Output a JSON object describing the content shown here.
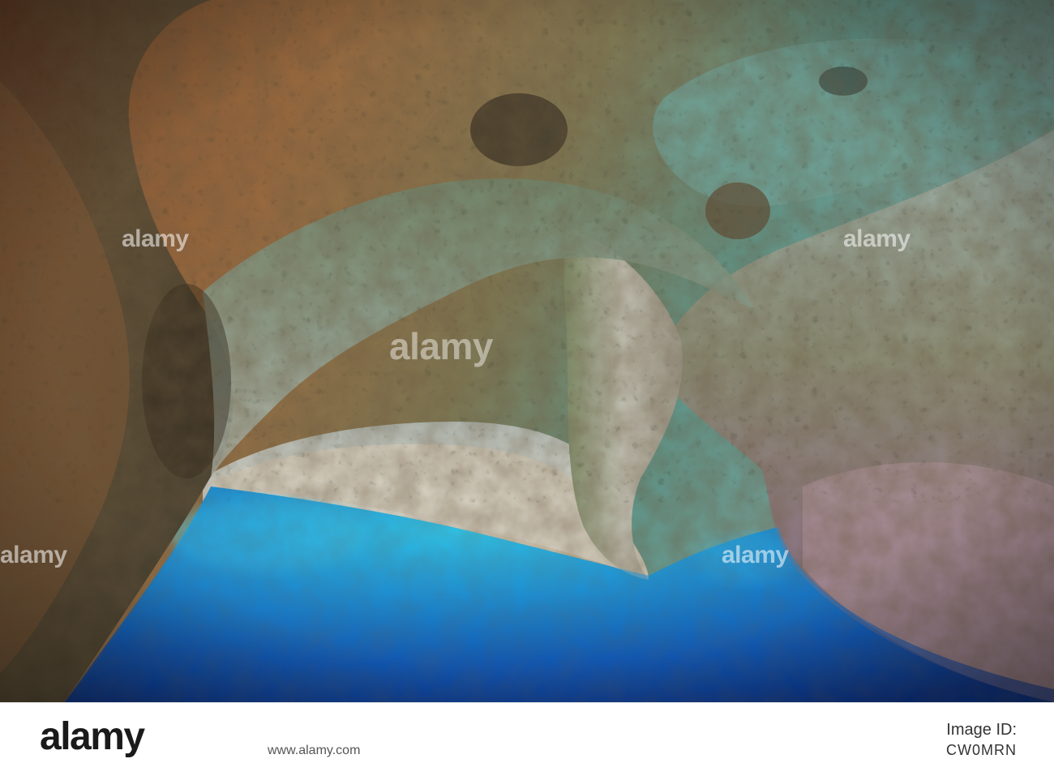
{
  "image": {
    "subject": "sea cave interior with turquoise water",
    "colors": {
      "water_light": "#27b4e0",
      "water_deep": "#0a3f9e",
      "rock_warm": "#a0603a",
      "rock_teal": "#4f8f86",
      "rock_pale": "#d8d6d0",
      "rock_shadow": "#2a2118"
    }
  },
  "watermark": {
    "text": "alamy",
    "center_text": "alamy"
  },
  "footer": {
    "logo": "alamy",
    "image_id": "CW0MRN",
    "url": "www.alamy.com",
    "image_id_label": "Image ID:"
  }
}
